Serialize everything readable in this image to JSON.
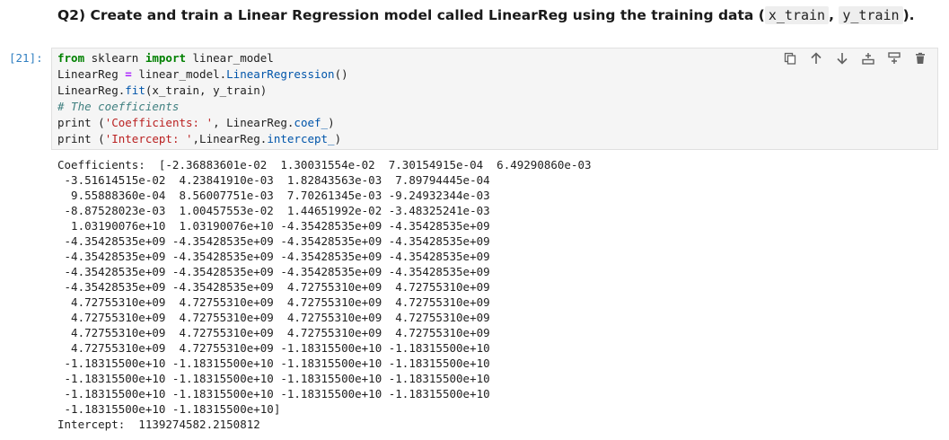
{
  "markdown": {
    "prefix": "Q2) Create and train a Linear Regression model called LinearReg using the training data (",
    "code1": "x_train",
    "sep": ",",
    "code2": "y_train",
    "suffix": ")."
  },
  "cell": {
    "prompt": "[21]:",
    "code": {
      "l1_kw": "from",
      "l1_mod": " sklearn ",
      "l1_kw2": "import",
      "l1_rest": " linear_model",
      "l2_a": "LinearReg ",
      "l2_op": "=",
      "l2_b": " linear_model.",
      "l2_fn": "LinearRegression",
      "l2_c": "()",
      "l3_a": "LinearReg.",
      "l3_fn": "fit",
      "l3_b": "(x_train, y_train)",
      "l4_cm": "# The coefficients",
      "l5_a": "print (",
      "l5_st": "'Coefficients: '",
      "l5_b": ", LinearReg.",
      "l5_fn": "coef_",
      "l5_c": ")",
      "l6_a": "print (",
      "l6_st": "'Intercept: '",
      "l6_b": ",LinearReg.",
      "l6_fn": "intercept_",
      "l6_c": ")"
    },
    "toolbar": [
      {
        "name": "copy-cell-icon"
      },
      {
        "name": "move-up-icon"
      },
      {
        "name": "move-down-icon"
      },
      {
        "name": "insert-above-icon"
      },
      {
        "name": "insert-below-icon"
      },
      {
        "name": "delete-cell-icon"
      }
    ]
  },
  "output": [
    "Coefficients:  [-2.36883601e-02  1.30031554e-02  7.30154915e-04  6.49290860e-03",
    " -3.51614515e-02  4.23841910e-03  1.82843563e-03  7.89794445e-04",
    "  9.55888360e-04  8.56007751e-03  7.70261345e-03 -9.24932344e-03",
    " -8.87528023e-03  1.00457553e-02  1.44651992e-02 -3.48325241e-03",
    "  1.03190076e+10  1.03190076e+10 -4.35428535e+09 -4.35428535e+09",
    " -4.35428535e+09 -4.35428535e+09 -4.35428535e+09 -4.35428535e+09",
    " -4.35428535e+09 -4.35428535e+09 -4.35428535e+09 -4.35428535e+09",
    " -4.35428535e+09 -4.35428535e+09 -4.35428535e+09 -4.35428535e+09",
    " -4.35428535e+09 -4.35428535e+09  4.72755310e+09  4.72755310e+09",
    "  4.72755310e+09  4.72755310e+09  4.72755310e+09  4.72755310e+09",
    "  4.72755310e+09  4.72755310e+09  4.72755310e+09  4.72755310e+09",
    "  4.72755310e+09  4.72755310e+09  4.72755310e+09  4.72755310e+09",
    "  4.72755310e+09  4.72755310e+09 -1.18315500e+10 -1.18315500e+10",
    " -1.18315500e+10 -1.18315500e+10 -1.18315500e+10 -1.18315500e+10",
    " -1.18315500e+10 -1.18315500e+10 -1.18315500e+10 -1.18315500e+10",
    " -1.18315500e+10 -1.18315500e+10 -1.18315500e+10 -1.18315500e+10",
    " -1.18315500e+10 -1.18315500e+10]",
    "Intercept:  1139274582.2150812"
  ]
}
